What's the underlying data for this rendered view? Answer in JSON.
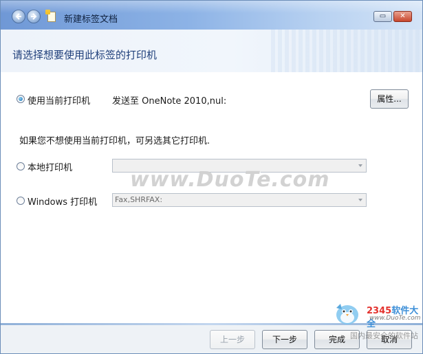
{
  "window": {
    "title": "新建标签文档",
    "heading": "请选择想要使用此标签的打印机"
  },
  "options": {
    "current": {
      "label": "使用当前打印机",
      "detail": "发送至 OneNote 2010,nul:",
      "button": "属性..."
    },
    "hint": "如果您不想使用当前打印机，可另选其它打印机.",
    "local": {
      "label": "本地打印机",
      "value": ""
    },
    "windows": {
      "label": "Windows 打印机",
      "value": "Fax,SHRFAX:"
    }
  },
  "footer": {
    "back": "上一步",
    "next": "下一步",
    "finish": "完成",
    "cancel": "取消"
  },
  "watermarks": {
    "main": "www.DuoTe.com",
    "brand_prefix": "2345",
    "brand_suffix": "软件大全",
    "url": "www.DuoTe.com",
    "slogan": "国内最安全的软件站"
  },
  "icons": {
    "back": "back-arrow-icon",
    "forward": "forward-arrow-icon",
    "document": "document-icon",
    "maximize": "maximize-icon",
    "close": "close-icon"
  }
}
